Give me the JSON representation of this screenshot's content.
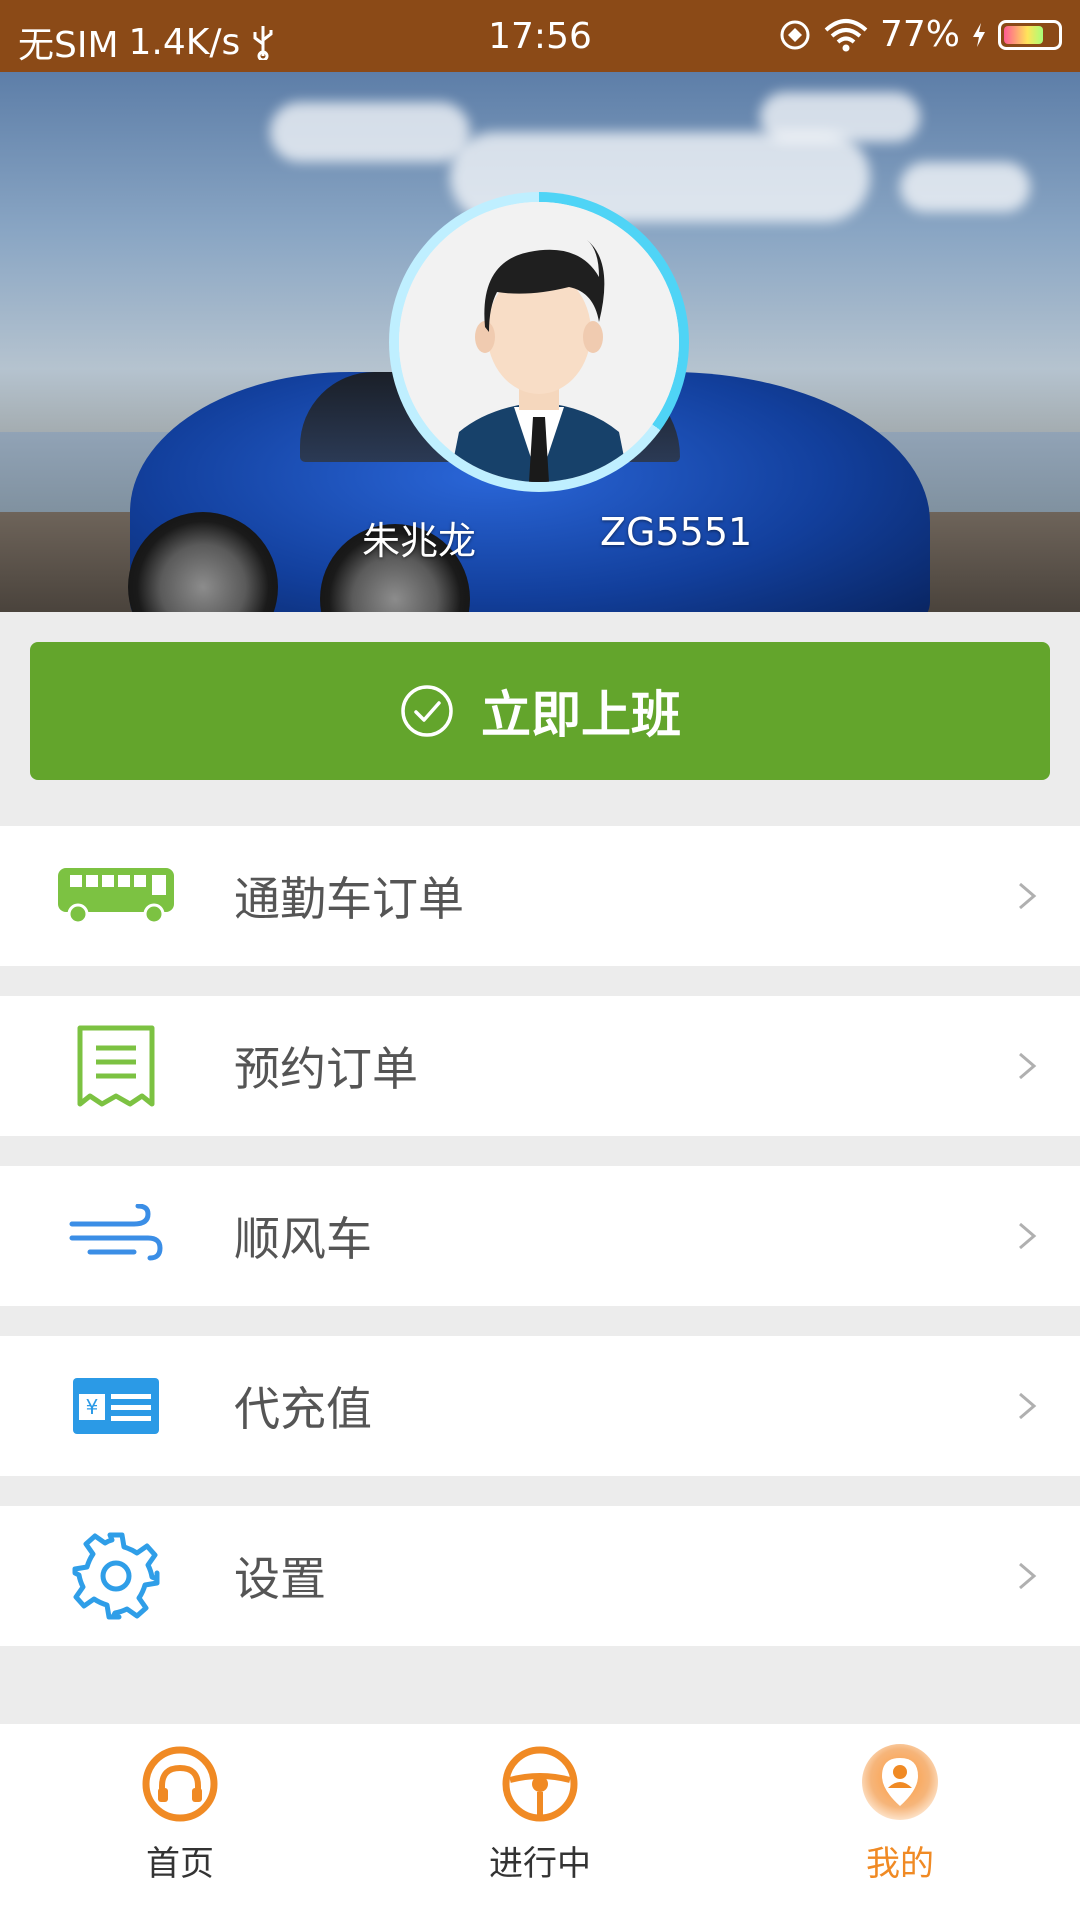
{
  "status_bar": {
    "carrier": "无SIM",
    "speed": "1.4K/s",
    "time": "17:56",
    "battery_percent": "77%",
    "battery_level": 0.77
  },
  "profile": {
    "name": "朱兆龙",
    "plate": "ZG5551"
  },
  "primary_action": {
    "label": "立即上班",
    "color": "#63a52c"
  },
  "menu": {
    "items": [
      {
        "label": "通勤车订单",
        "icon": "bus-icon"
      },
      {
        "label": "预约订单",
        "icon": "receipt-icon"
      },
      {
        "label": "顺风车",
        "icon": "wind-icon"
      },
      {
        "label": "代充值",
        "icon": "recharge-card-icon"
      },
      {
        "label": "设置",
        "icon": "gear-icon"
      }
    ]
  },
  "bottom_nav": {
    "items": [
      {
        "label": "首页",
        "icon": "headphones-icon"
      },
      {
        "label": "进行中",
        "icon": "steering-wheel-icon"
      },
      {
        "label": "我的",
        "icon": "user-pin-icon",
        "active": true
      }
    ],
    "accent": "#f08a24"
  }
}
